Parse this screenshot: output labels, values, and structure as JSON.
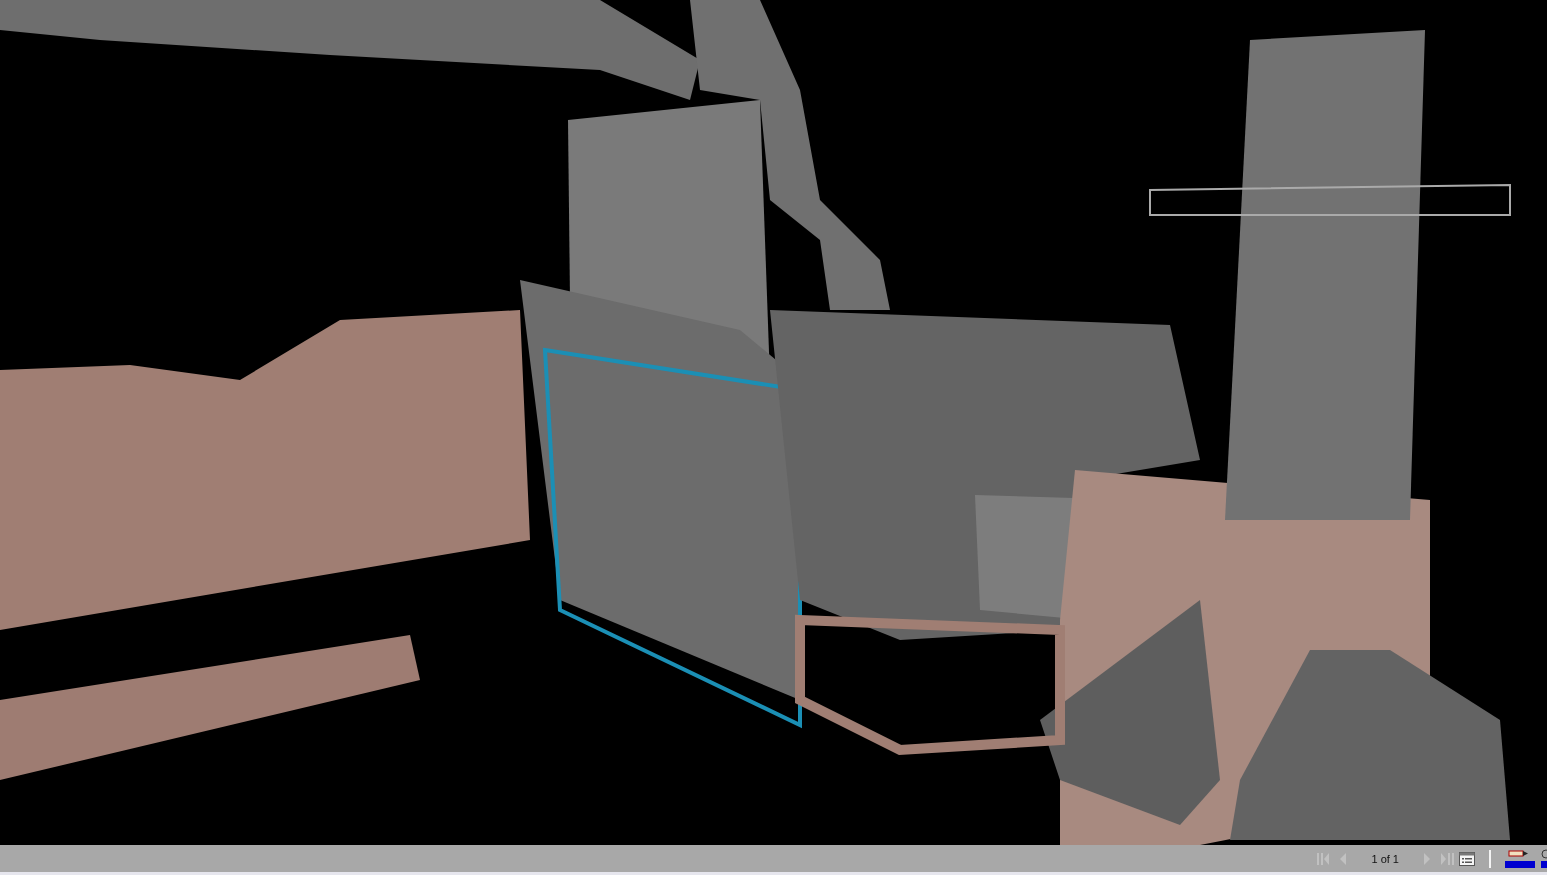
{
  "status_bar": {
    "nav": [
      {
        "kind": "first",
        "disabled": true
      },
      {
        "kind": "prev",
        "disabled": true
      },
      {
        "kind": "next",
        "disabled": true
      },
      {
        "kind": "last",
        "disabled": true
      }
    ],
    "page": "1 of 1"
  }
}
